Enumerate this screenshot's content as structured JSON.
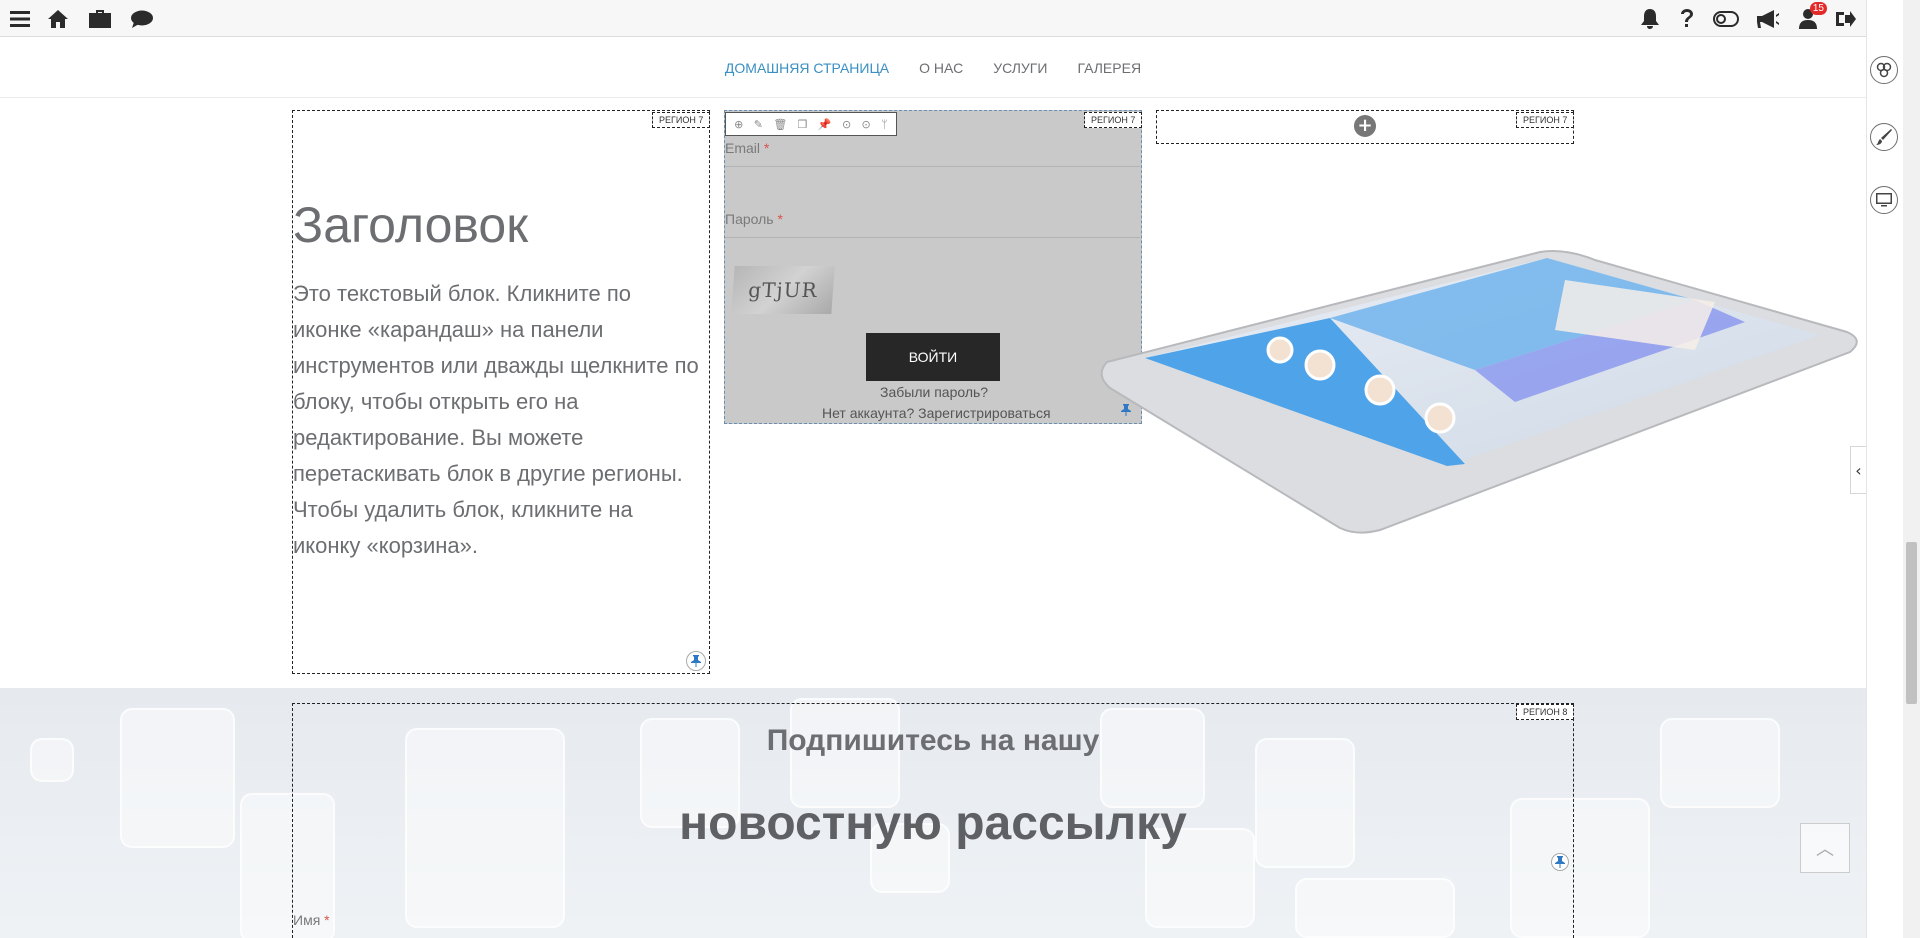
{
  "topbar": {
    "icons_left": [
      "menu-icon",
      "home-icon",
      "briefcase-icon",
      "chat-icon"
    ],
    "icons_right": [
      "bell-icon",
      "help-icon",
      "toggle-icon",
      "megaphone-icon",
      "user-icon",
      "logout-icon"
    ],
    "notification_count": "15"
  },
  "nav": {
    "items": [
      {
        "label": "ДОМАШНЯЯ СТРАНИЦА",
        "active": true
      },
      {
        "label": "О НАС",
        "active": false
      },
      {
        "label": "УСЛУГИ",
        "active": false
      },
      {
        "label": "ГАЛЕРЕЯ",
        "active": false
      }
    ]
  },
  "regions": {
    "region7_label": "РЕГИОН 7",
    "region8_label": "РЕГИОН 8"
  },
  "text_block": {
    "heading": "Заголовок",
    "body": "Это текстовый блок. Кликните по иконке «карандаш» на панели инструментов или дважды щелкните по блоку, чтобы открыть его на редактирование. Вы можете перетаскивать блок в другие регионы. Чтобы удалить блок, кликните на иконку «корзина»."
  },
  "login_form": {
    "email_label": "Email",
    "password_label": "Пароль",
    "required_mark": "*",
    "captcha_text": "gTjUR",
    "submit_label": "ВОЙТИ",
    "forgot_password": "Забыли пароль?",
    "register_prompt": "Нет аккаунта? Зарегистрироваться"
  },
  "newsletter": {
    "title": "Подпишитесь на нашу",
    "subtitle": "новостную рассылку",
    "name_label": "Имя",
    "required_mark": "*"
  },
  "colors": {
    "accent_nav": "#3a8fc3",
    "text_gray": "#6d6e71",
    "button_dark": "#272727",
    "pin_blue": "#2f78c4",
    "required_red": "#d9534f"
  }
}
